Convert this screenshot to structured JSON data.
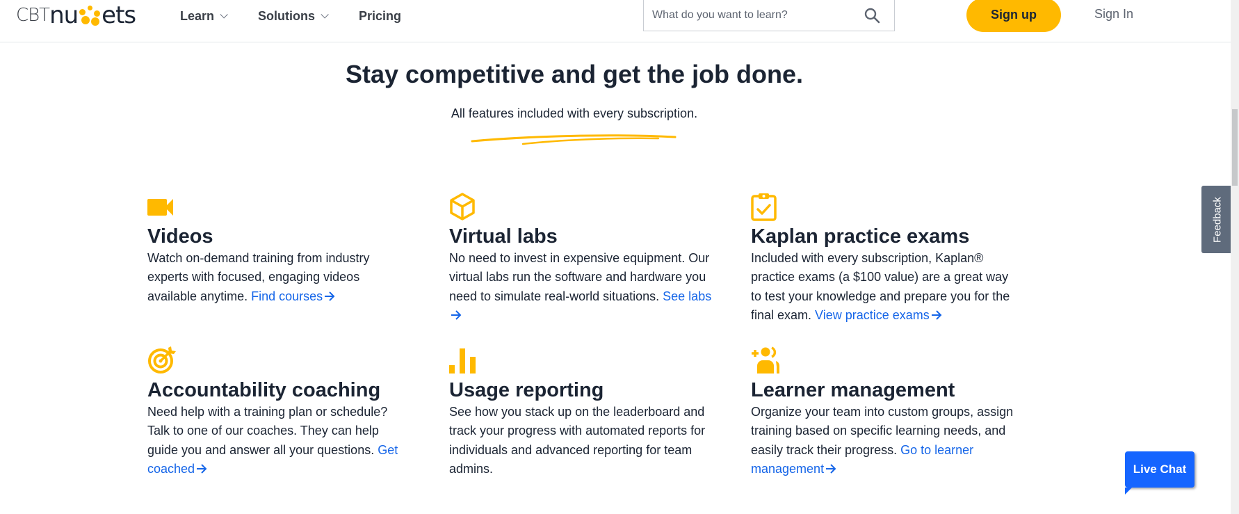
{
  "header": {
    "logo": {
      "part1": "CBT",
      "part2": "nu",
      "part3": "ets"
    },
    "nav": [
      {
        "label": "Learn",
        "has_dropdown": true
      },
      {
        "label": "Solutions",
        "has_dropdown": true
      },
      {
        "label": "Pricing",
        "has_dropdown": false
      }
    ],
    "search": {
      "placeholder": "What do you want to learn?",
      "value": ""
    },
    "signup_label": "Sign up",
    "signin_label": "Sign In"
  },
  "hero": {
    "title": "Stay competitive and get the job done.",
    "subtitle": "All features included with every subscription."
  },
  "features": [
    {
      "icon": "video-camera-icon",
      "title": "Videos",
      "text": "Watch on-demand training from industry experts with focused, engaging videos available anytime. ",
      "link": "Find courses"
    },
    {
      "icon": "cube-icon",
      "title": "Virtual labs",
      "text": "No need to invest in expensive equipment. Our virtual labs run the software and hardware you need to simulate real-world situations. ",
      "link": "See labs"
    },
    {
      "icon": "clipboard-check-icon",
      "title": "Kaplan practice exams",
      "text": "Included with every subscription, Kaplan® practice exams (a $100 value) are a great way to test your knowledge and prepare you for the final exam. ",
      "link": "View practice exams"
    },
    {
      "icon": "target-icon",
      "title": "Accountability coaching",
      "text": "Need help with a training plan or schedule? Talk to one of our coaches. They can help guide you and answer all your questions. ",
      "link": "Get coached"
    },
    {
      "icon": "bar-chart-icon",
      "title": "Usage reporting",
      "text": "See how you stack up on the leaderboard and track your progress with automated reports for individuals and advanced reporting for team admins.",
      "link": ""
    },
    {
      "icon": "add-users-icon",
      "title": "Learner management",
      "text": "Organize your team into custom groups, assign training based on specific learning needs, and easily track their progress. ",
      "link": "Go to learner management"
    }
  ],
  "widgets": {
    "feedback_label": "Feedback",
    "livechat_label": "Live Chat"
  },
  "colors": {
    "accent": "#ffb900",
    "link": "#1565e8",
    "text": "#1b2433",
    "livechat": "#1565ff",
    "feedback": "#5f6b7c"
  }
}
